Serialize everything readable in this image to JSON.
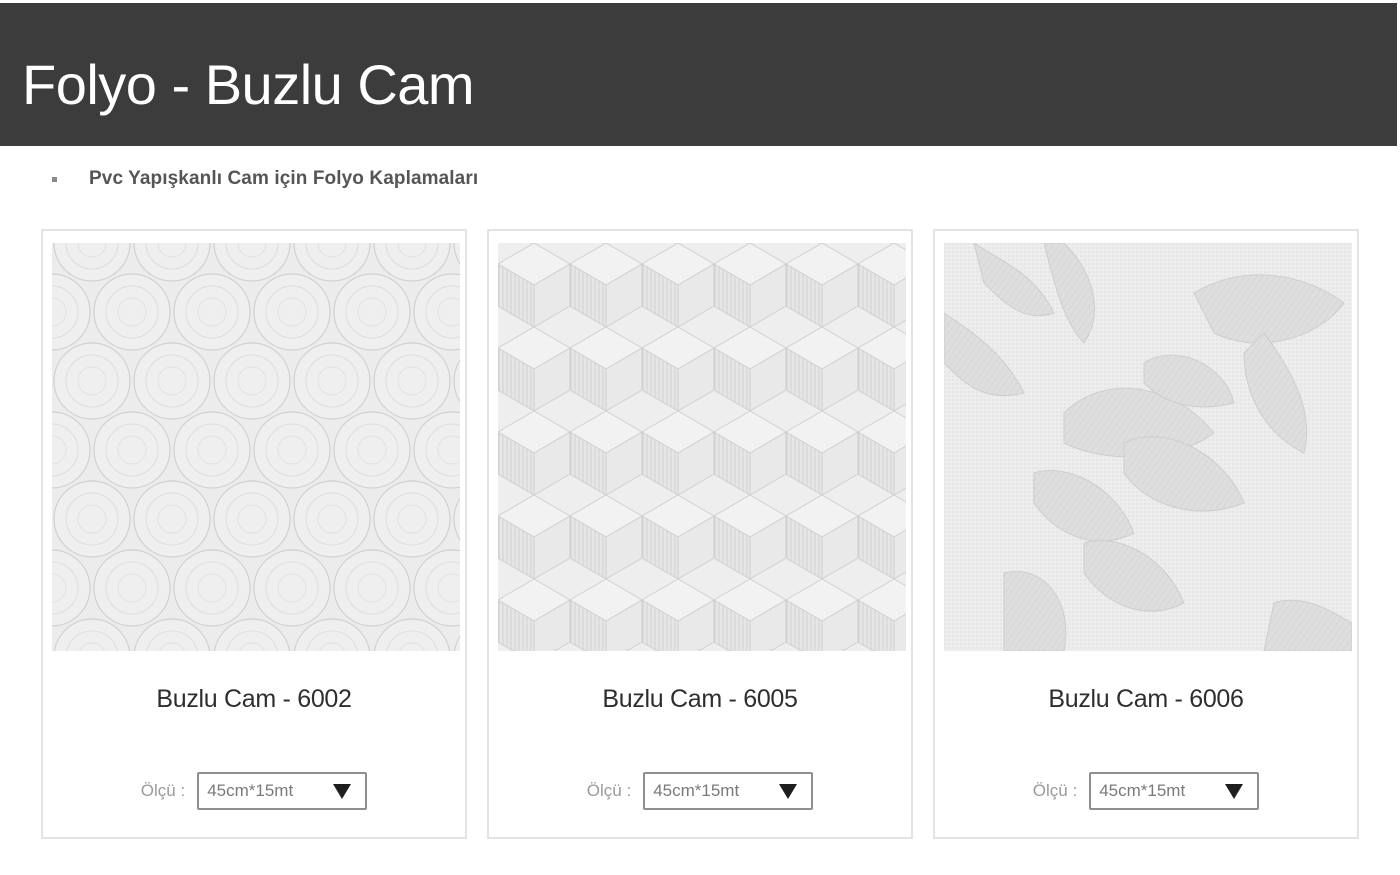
{
  "header": {
    "title": "Folyo - Buzlu Cam"
  },
  "subtitle": "Pvc Yapışkanlı Cam için Folyo Kaplamaları",
  "products": [
    {
      "name": "Buzlu Cam - 6002",
      "size_label": "Ölçü :",
      "size_value": "45cm*15mt",
      "pattern": "circles"
    },
    {
      "name": "Buzlu Cam - 6005",
      "size_label": "Ölçü :",
      "size_value": "45cm*15mt",
      "pattern": "cubes"
    },
    {
      "name": "Buzlu Cam - 6006",
      "size_label": "Ölçü :",
      "size_value": "45cm*15mt",
      "pattern": "floral"
    }
  ],
  "colors": {
    "header_bg": "#3c3c3c",
    "header_text": "#ffffff",
    "card_border": "#e3e3e3",
    "pattern_bg": "#ededed",
    "pattern_line": "#c9c9c9"
  }
}
